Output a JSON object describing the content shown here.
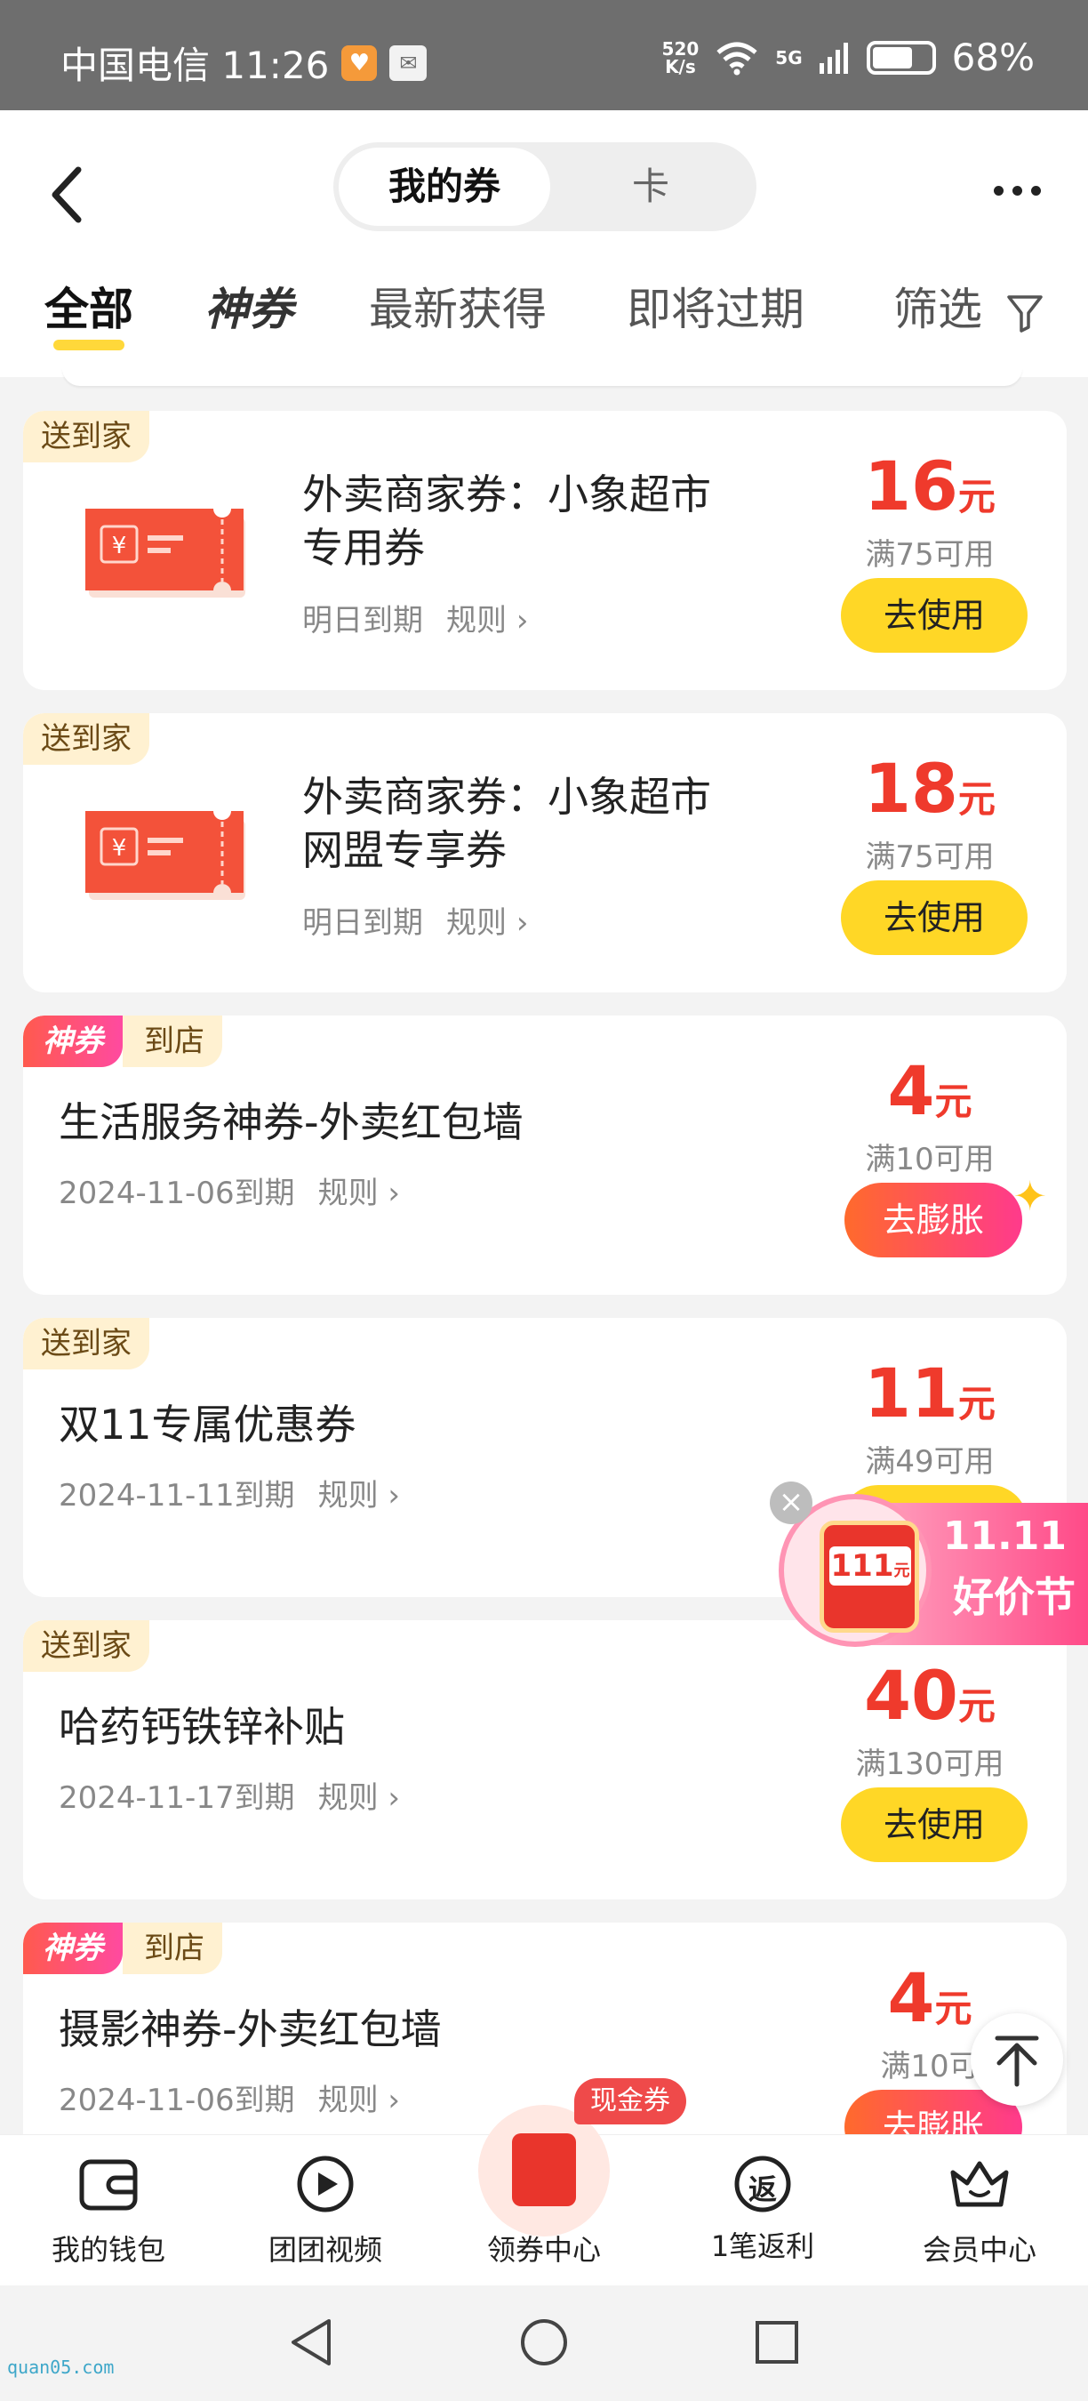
{
  "status_bar": {
    "carrier_time": "中国电信 11:26",
    "speed_top": "520",
    "speed_bottom": "K/s",
    "network": "5G",
    "battery": "68%"
  },
  "header": {
    "segments": [
      "我的券",
      "卡"
    ],
    "active_segment": "我的券"
  },
  "tabs": [
    "全部",
    "神券",
    "最新获得",
    "即将过期",
    "筛选"
  ],
  "active_tab": "全部",
  "coupons": [
    {
      "tags": [
        "送到家"
      ],
      "title_line1": "外卖商家券：小象超市",
      "title_line2": "专用券",
      "expiry": "明日到期",
      "rule": "规则",
      "amount": "16",
      "unit": "元",
      "condition": "满75可用",
      "action": "去使用"
    },
    {
      "tags": [
        "送到家"
      ],
      "title_line1": "外卖商家券：小象超市",
      "title_line2": "网盟专享券",
      "expiry": "明日到期",
      "rule": "规则",
      "amount": "18",
      "unit": "元",
      "condition": "满75可用",
      "action": "去使用"
    },
    {
      "tags": [
        "神券",
        "到店"
      ],
      "title_line1": "生活服务神券-外卖红包墙",
      "expiry": "2024-11-06到期",
      "rule": "规则",
      "amount": "4",
      "unit": "元",
      "condition": "满10可用",
      "action": "去膨胀"
    },
    {
      "tags": [
        "送到家"
      ],
      "title_line1": "双11专属优惠券",
      "expiry": "2024-11-11到期",
      "rule": "规则",
      "amount": "11",
      "unit": "元",
      "condition": "满49可用",
      "action": ""
    },
    {
      "tags": [
        "送到家"
      ],
      "title_line1": "哈药钙铁锌补贴",
      "expiry": "2024-11-17到期",
      "rule": "规则",
      "amount": "40",
      "unit": "元",
      "condition": "满130可用",
      "action": "去使用"
    },
    {
      "tags": [
        "神券",
        "到店"
      ],
      "title_line1": "摄影神券-外卖红包墙",
      "expiry": "2024-11-06到期",
      "rule": "规则",
      "amount": "4",
      "unit": "元",
      "condition": "满10可",
      "action": "去膨胀"
    }
  ],
  "promo": {
    "envelope_value": "111",
    "envelope_unit": "元",
    "line1": "11.11",
    "line2": "好价节"
  },
  "bottom_nav": {
    "items": [
      "我的钱包",
      "团团视频",
      "领券中心",
      "1笔返利",
      "会员中心"
    ],
    "center_badge": "现金券",
    "rebate_glyph": "返"
  },
  "watermark": "quan05.com",
  "colors": {
    "accent_yellow": "#ffd726",
    "price_red": "#ef3a2c",
    "tag_bg": "#fff1d1"
  }
}
